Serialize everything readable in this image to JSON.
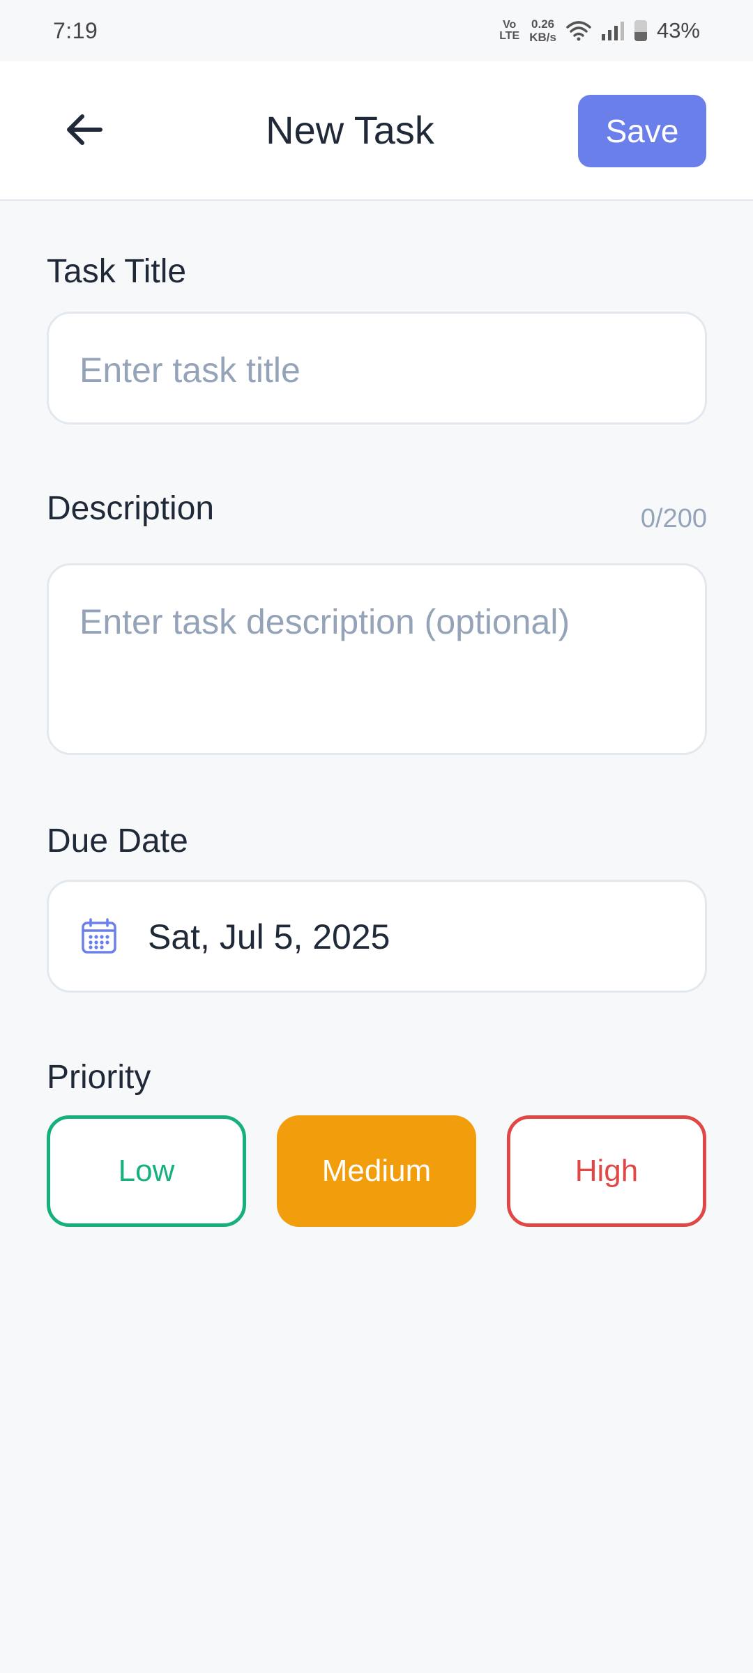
{
  "status_bar": {
    "time": "7:19",
    "volte_top": "Vo",
    "volte_bottom": "LTE",
    "speed_value": "0.26",
    "speed_unit": "KB/s",
    "battery": "43%"
  },
  "header": {
    "title": "New Task",
    "save_label": "Save",
    "accent": "#6b7feb"
  },
  "form": {
    "title": {
      "label": "Task Title",
      "placeholder": "Enter task title"
    },
    "description": {
      "label": "Description",
      "placeholder": "Enter task description (optional)",
      "counter": "0/200"
    },
    "due_date": {
      "label": "Due Date",
      "value": "Sat, Jul 5, 2025"
    },
    "priority": {
      "label": "Priority",
      "options": [
        {
          "label": "Low",
          "color": "#16b07f",
          "selected": false
        },
        {
          "label": "Medium",
          "color": "#f29d0c",
          "selected": true
        },
        {
          "label": "High",
          "color": "#e04848",
          "selected": false
        }
      ]
    }
  },
  "icons": {
    "back": "arrow-left-icon",
    "calendar": "calendar-icon",
    "wifi": "wifi-icon",
    "signal": "signal-icon",
    "battery": "battery-icon"
  }
}
